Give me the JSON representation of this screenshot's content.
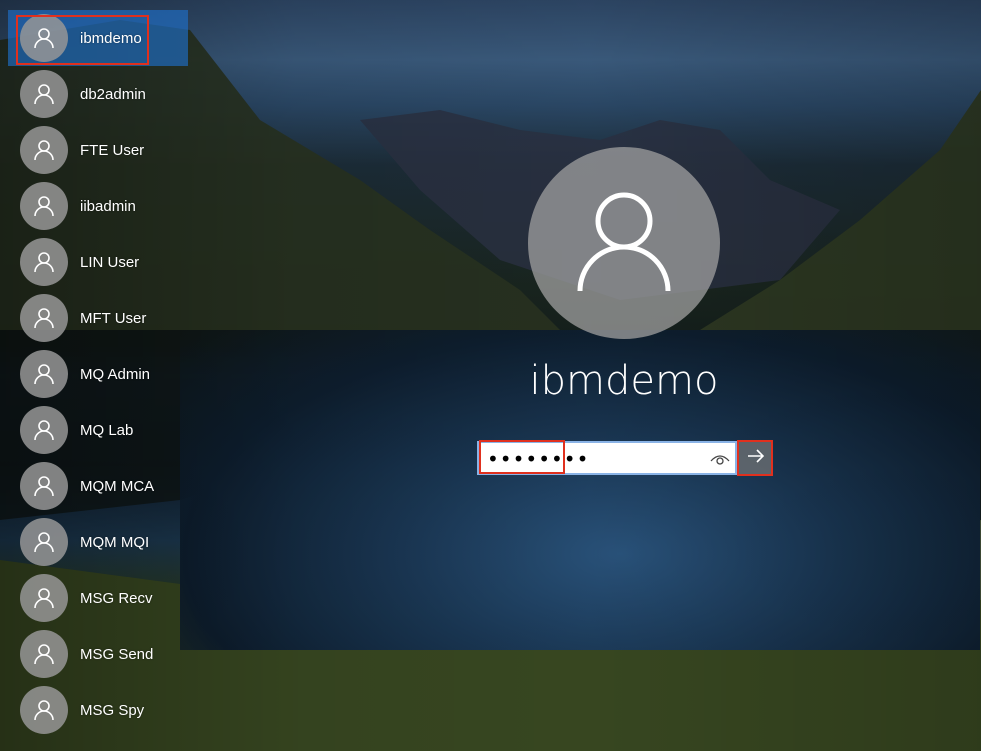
{
  "users": [
    {
      "name": "ibmdemo"
    },
    {
      "name": "db2admin"
    },
    {
      "name": "FTE User"
    },
    {
      "name": "iibadmin"
    },
    {
      "name": "LIN User"
    },
    {
      "name": "MFT User"
    },
    {
      "name": "MQ Admin"
    },
    {
      "name": "MQ Lab"
    },
    {
      "name": "MQM MCA"
    },
    {
      "name": "MQM MQI"
    },
    {
      "name": "MSG Recv"
    },
    {
      "name": "MSG Send"
    },
    {
      "name": "MSG Spy"
    }
  ],
  "selected_user": "ibmdemo",
  "login": {
    "username": "ibmdemo",
    "password_masked": "••••••••",
    "reveal_icon": "eye-icon",
    "submit_icon": "arrow-right-icon"
  },
  "colors": {
    "selection": "#1e6ec8",
    "highlight_box": "#e0301e",
    "avatar_bg": "#969696"
  }
}
